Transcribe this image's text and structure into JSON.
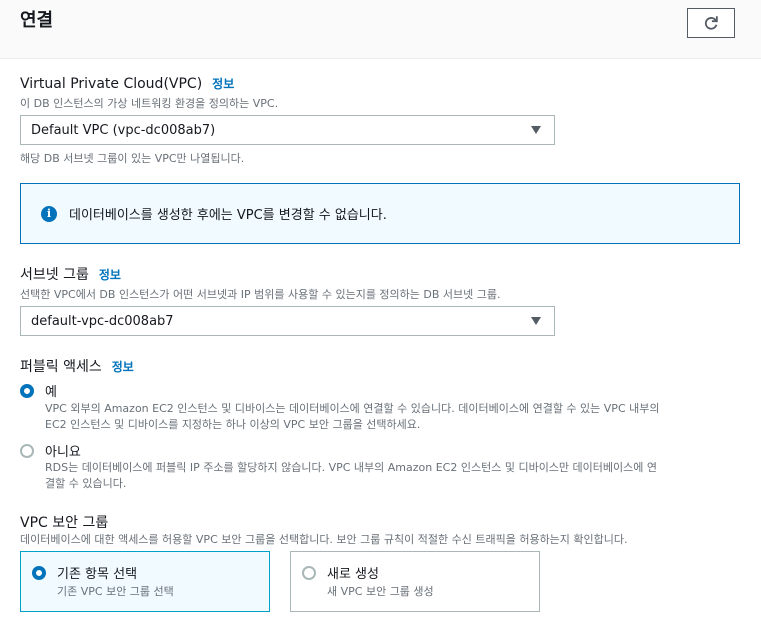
{
  "section": {
    "title": "연결",
    "refresh_icon": "refresh-icon"
  },
  "vpc": {
    "label": "Virtual Private Cloud(VPC)",
    "info": "정보",
    "description": "이 DB 인스턴스의 가상 네트워킹 환경을 정의하는 VPC.",
    "selected": "Default VPC (vpc-dc008ab7)",
    "hint": "해당 DB 서브넷 그룹이 있는 VPC만 나열됩니다."
  },
  "notice": {
    "icon": "info-icon",
    "text": "데이터베이스를 생성한 후에는 VPC를 변경할 수 없습니다."
  },
  "subnet": {
    "label": "서브넷 그룹",
    "info": "정보",
    "description": "선택한 VPC에서 DB 인스턴스가 어떤 서브넷과 IP 범위를 사용할 수 있는지를 정의하는 DB 서브넷 그룹.",
    "selected": "default-vpc-dc008ab7"
  },
  "public_access": {
    "label": "퍼블릭 액세스",
    "info": "정보",
    "options": [
      {
        "label": "예",
        "checked": true,
        "description_line1": "VPC 외부의 Amazon EC2 인스턴스 및 디바이스는 데이터베이스에 연결할 수 있습니다. 데이터베이스에 연결할 수 있는 VPC 내부의",
        "description_line2": "EC2 인스턴스 및 디바이스를 지정하는 하나 이상의 VPC 보안 그룹을 선택하세요."
      },
      {
        "label": "아니요",
        "checked": false,
        "description_line1": "RDS는 데이터베이스에 퍼블릭 IP 주소를 할당하지 않습니다. VPC 내부의 Amazon EC2 인스턴스 및 디바이스만 데이터베이스에 연",
        "description_line2": "결할 수 있습니다."
      }
    ]
  },
  "security_group": {
    "label": "VPC 보안 그룹",
    "description": "데이터베이스에 대한 액세스를 허용할 VPC 보안 그룹을 선택합니다. 보안 그룹 규칙이 적절한 수신 트래픽을 허용하는지 확인합니다.",
    "tiles": [
      {
        "label": "기존 항목 선택",
        "description": "기존 VPC 보안 그룹 선택",
        "selected": true
      },
      {
        "label": "새로 생성",
        "description": "새 VPC 보안 그룹 생성",
        "selected": false
      }
    ]
  },
  "colors": {
    "accent": "#0073bb",
    "selected_border": "#00a1c9",
    "info_bg": "#f1faff",
    "muted_text": "#687078"
  }
}
